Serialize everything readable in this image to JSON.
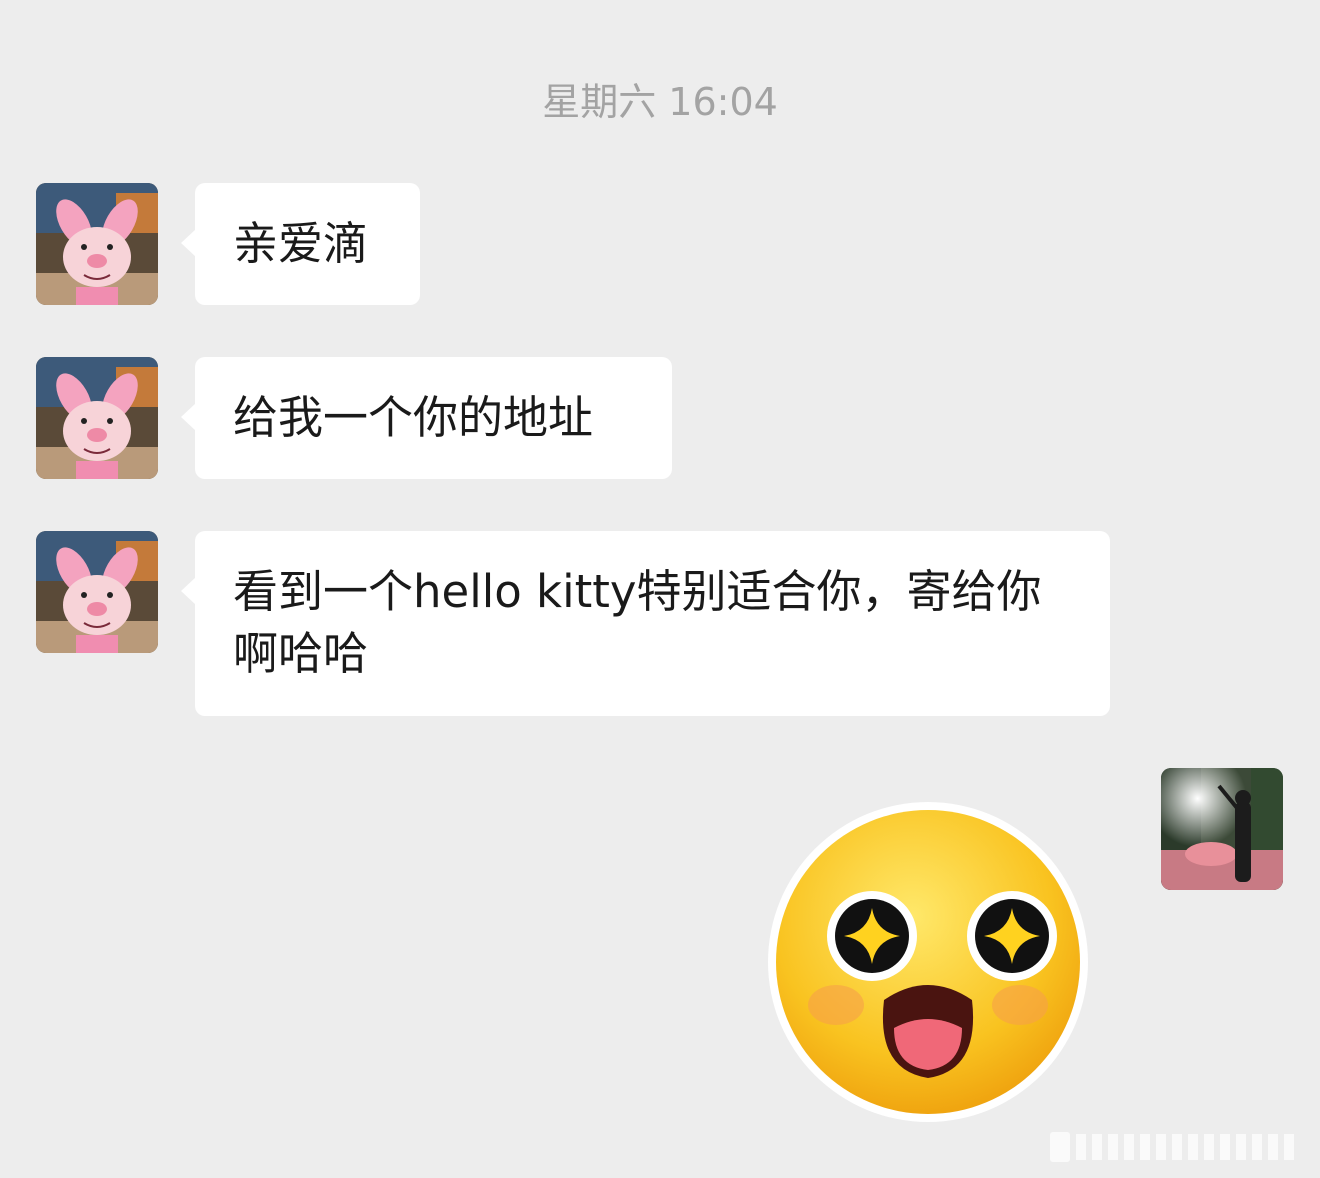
{
  "chat": {
    "timestamp": "星期六 16:04",
    "messages": [
      {
        "sender": "contact",
        "text": "亲爱滴"
      },
      {
        "sender": "contact",
        "text": "给我一个你的地址"
      },
      {
        "sender": "contact",
        "text": "看到一个hello kitty特别适合你，寄给你啊哈哈"
      },
      {
        "sender": "me",
        "type": "sticker",
        "sticker": "starry-eyes-emoji"
      }
    ]
  },
  "avatars": {
    "contact": "piglet-plush-avatar",
    "me": "woman-in-forest-avatar"
  }
}
